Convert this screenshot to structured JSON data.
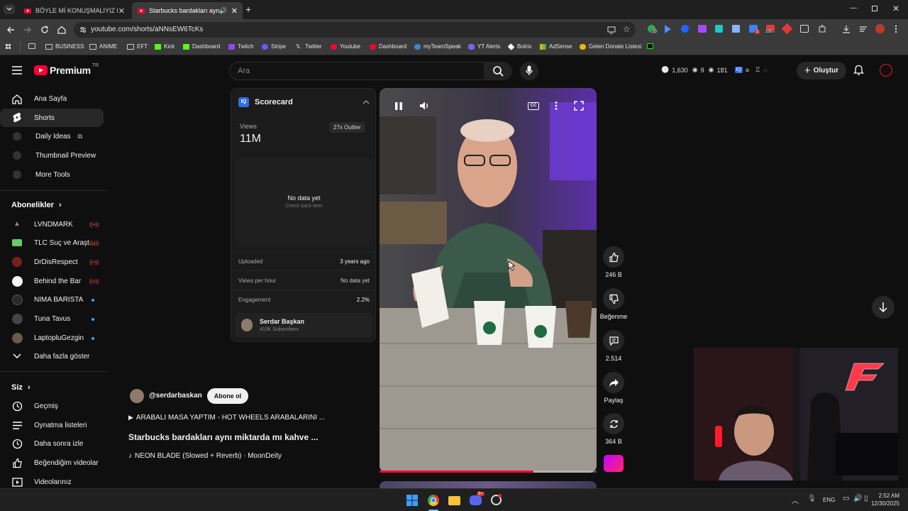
{
  "browser": {
    "tabs": [
      {
        "label": "BÖYLE Mİ KONUŞMALIYIZ KON"
      },
      {
        "label": "Starbucks bardakları aynı m"
      }
    ],
    "url": "youtube.com/shorts/aNNsEW6TcKs",
    "bookmarks": [
      "BUSINESS",
      "ANIME",
      "EFT",
      "Kick",
      "Dashboard",
      "Twitch",
      "Stripe",
      "Twitter",
      "Youtube",
      "Dashboard",
      "myTeamSpeak",
      "YT Alerts",
      "Botrix",
      "AdSense",
      "Gelen Donate Listesi"
    ],
    "ext_badges": {
      "e1": "10",
      "e2": "1",
      "e3": "100"
    }
  },
  "header": {
    "logo_text": "Premium",
    "logo_sup": "TR",
    "search_placeholder": "Ara",
    "stats": {
      "s1": "1,630",
      "s2": "9",
      "s3": "181"
    },
    "create_label": "Oluştur"
  },
  "sidebar": {
    "main": [
      {
        "label": "Ana Sayfa",
        "icon": "home-icon"
      },
      {
        "label": "Shorts",
        "icon": "shorts-icon"
      },
      {
        "label": "Daily Ideas",
        "icon": "vidiq-icon"
      },
      {
        "label": "Thumbnail Preview",
        "icon": "vidiq-icon"
      },
      {
        "label": "More Tools",
        "icon": "vidiq-icon"
      }
    ],
    "subs_title": "Abonelikler",
    "subs": [
      {
        "label": "LVNDMARK",
        "badge": "live"
      },
      {
        "label": "TLC Suç ve Araşt...",
        "badge": "live"
      },
      {
        "label": "DrDisRespect",
        "badge": "live"
      },
      {
        "label": "Behind the Bar",
        "badge": "live"
      },
      {
        "label": "NIMA BARISTA",
        "badge": "new"
      },
      {
        "label": "Tuna Tavus",
        "badge": "new"
      },
      {
        "label": "LaptopluGezgin",
        "badge": "new"
      }
    ],
    "show_more": "Daha fazla göster",
    "you_title": "Siz",
    "you": [
      {
        "label": "Geçmiş",
        "icon": "history-icon"
      },
      {
        "label": "Oynatma listeleri",
        "icon": "playlist-icon"
      },
      {
        "label": "Daha sonra izle",
        "icon": "clock-icon"
      },
      {
        "label": "Beğendiğim videolar",
        "icon": "like-icon"
      },
      {
        "label": "Videolarınız",
        "icon": "video-icon"
      }
    ]
  },
  "scorecard": {
    "title": "Scorecard",
    "views_label": "Views",
    "views_value": "11M",
    "outlier": "27x Outlier",
    "no_data": "No data yet",
    "no_data_sub": "Check back later",
    "rows": [
      {
        "label": "Uploaded",
        "value": "3 years ago"
      },
      {
        "label": "Views per hour",
        "value": "No data yet"
      },
      {
        "label": "Engagement",
        "value": "2.2%"
      }
    ],
    "channel_name": "Serdar Başkan",
    "channel_subs": "410K Subscribers"
  },
  "short": {
    "channel": "@serdarbaskan",
    "subscribe": "Abone ol",
    "related": "ARABALI MASA YAPTIM - HOT WHEELS ARABALARINI ...",
    "title": "Starbucks bardakları aynı miktarda mı kahve ...",
    "music": "NEON BLADE (Slowed + Reverb) · MoonDeity",
    "progress": 0.71
  },
  "actions": {
    "likes": "246 B",
    "dislike": "Beğenme",
    "comments": "2.514",
    "share": "Paylaş",
    "remix": "364 B"
  },
  "taskbar": {
    "lang": "ENG",
    "time": "2:52 AM",
    "date": "12/30/2025",
    "discord_badge": "9+"
  }
}
